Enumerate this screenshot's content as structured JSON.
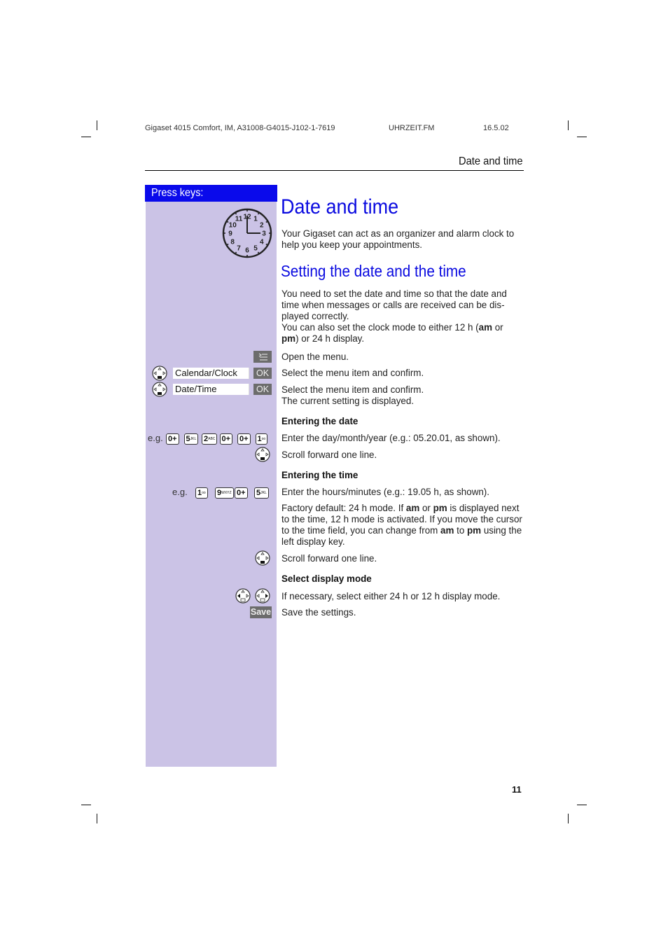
{
  "print_header": {
    "doc_id": "Gigaset 4015 Comfort, IM, A31008-G4015-J102-1-7619",
    "file": "UHRZEIT.FM",
    "date": "16.5.02"
  },
  "running_head": "Date and time",
  "left_column": {
    "header": "Press keys:",
    "clock_numbers": [
      "12",
      "1",
      "2",
      "3",
      "4",
      "5",
      "6",
      "7",
      "8",
      "9",
      "10",
      "11"
    ],
    "menu_key_icon": "menu-icon",
    "rows": [
      {
        "display": "Calendar/Clock",
        "softkey": "OK"
      },
      {
        "display": "Date/Time",
        "softkey": "OK"
      }
    ],
    "date_example": {
      "prefix": "e.g.",
      "keys": [
        {
          "digit": "0",
          "sub": "+"
        },
        {
          "digit": "5",
          "sub": "JKL"
        },
        {
          "digit": "2",
          "sub": "ABC"
        },
        {
          "digit": "0",
          "sub": "+"
        },
        {
          "digit": "0",
          "sub": "+"
        },
        {
          "digit": "1",
          "sub": "voicemail"
        }
      ]
    },
    "time_example": {
      "prefix": "e.g.",
      "keys": [
        {
          "digit": "1",
          "sub": "voicemail"
        },
        {
          "digit": "9",
          "sub": "WXYZ"
        },
        {
          "digit": "0",
          "sub": "+"
        },
        {
          "digit": "5",
          "sub": "JKL"
        }
      ]
    },
    "save_softkey": "Save"
  },
  "main": {
    "title": "Date and time",
    "intro": "Your Gigaset can act as an organizer and alarm clock to help you keep your appointments.",
    "section_title": "Setting the date and the time",
    "section_p1": "You need to set the date and time so that the date and time when messages or calls are received can be dis-played correctly.",
    "section_p2_a": "You can also set the clock mode to either 12 h (",
    "am": "am",
    "or": " or ",
    "pm": "pm",
    "section_p2_b": ") or 24 h display.",
    "steps": {
      "open_menu": "Open the menu.",
      "select1": "Select the menu item and confirm.",
      "select2": "Select the menu item and confirm.",
      "current": "The current setting is displayed."
    },
    "entering_date": {
      "heading": "Entering the date",
      "enter": "Enter the day/month/year (e.g.: 05.20.01, as shown).",
      "scroll": "Scroll forward one line."
    },
    "entering_time": {
      "heading": "Entering the time",
      "enter": "Enter the hours/minutes (e.g.: 19.05 h, as shown).",
      "factory_a": "Factory default: 24 h mode. If ",
      "factory_b": " is displayed next to the time, 12 h mode is activated. If you move the cursor to the time field, you can change from ",
      "factory_c": " to ",
      "factory_d": " using the left display key.",
      "scroll": "Scroll forward one line."
    },
    "display_mode": {
      "heading": "Select display mode",
      "select": "If necessary, select either 24 h or 12 h display mode.",
      "save": "Save the settings."
    }
  },
  "page_number": "11"
}
